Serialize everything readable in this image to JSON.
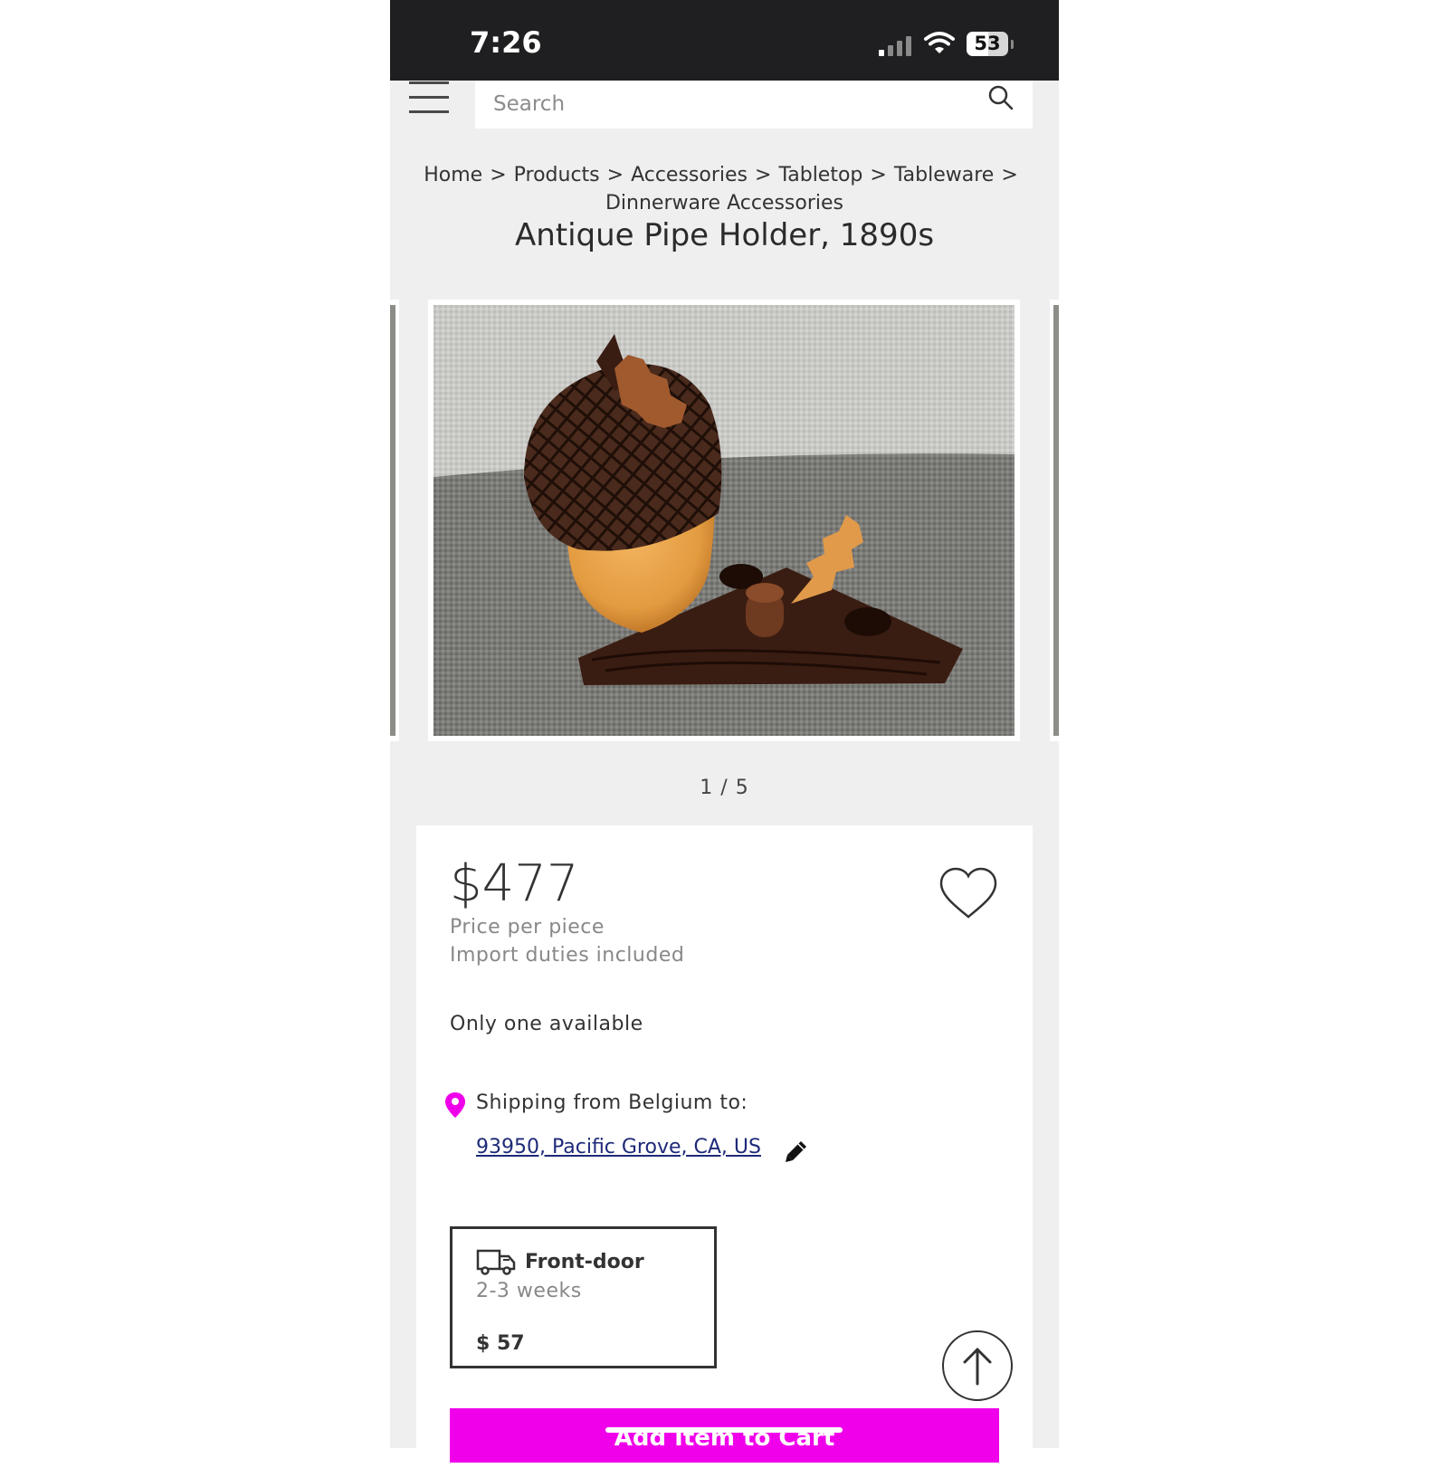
{
  "status_bar": {
    "time": "7:26",
    "battery": "53"
  },
  "search": {
    "placeholder": "Search"
  },
  "breadcrumb": [
    "Home",
    "Products",
    "Accessories",
    "Tabletop",
    "Tableware",
    "Dinnerware Accessories"
  ],
  "breadcrumb_separator": ">",
  "product": {
    "title": "Antique Pipe Holder, 1890s",
    "image_counter": "1 / 5",
    "price": "$477",
    "price_note": "Price per piece",
    "duties_note": "Import duties included",
    "availability": "Only one available"
  },
  "shipping": {
    "label": "Shipping from Belgium to:",
    "address": "93950, Pacific Grove, CA, US",
    "option": {
      "name": "Front-door",
      "time": "2-3 weeks",
      "price": "$ 57"
    }
  },
  "cart": {
    "label": "Add Item to Cart"
  },
  "icons": {
    "menu": "hamburger-menu-icon",
    "search": "search-icon",
    "favorite": "heart-icon",
    "location": "location-pin-icon",
    "edit": "pencil-icon",
    "delivery": "truck-icon",
    "scroll_top": "arrow-up-icon"
  },
  "colors": {
    "accent": "#f000ea",
    "link": "#1e2a78",
    "status_bar": "#1f1f21",
    "page_bg": "#efefef"
  }
}
